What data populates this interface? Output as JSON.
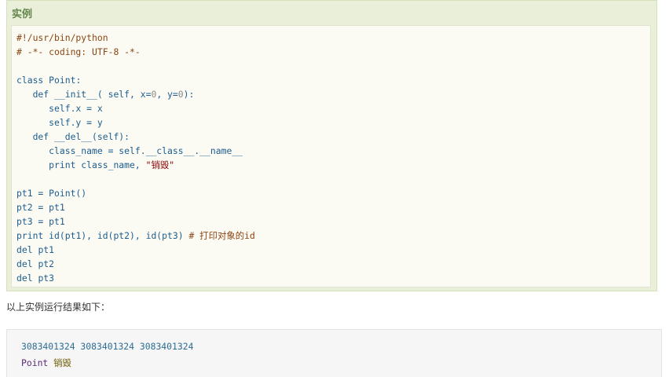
{
  "example": {
    "title": "实例",
    "code_lines": [
      [
        {
          "t": "#!/usr/bin/python",
          "c": "com"
        }
      ],
      [
        {
          "t": "# -*- coding: UTF-8 -*-",
          "c": "com"
        }
      ],
      [],
      [
        {
          "t": "class ",
          "c": "kw"
        },
        {
          "t": "Point:",
          "c": "pl"
        }
      ],
      [
        {
          "t": "   def ",
          "c": "kw"
        },
        {
          "t": "__init__( self, x=",
          "c": "pl"
        },
        {
          "t": "0",
          "c": "num"
        },
        {
          "t": ", y=",
          "c": "pl"
        },
        {
          "t": "0",
          "c": "num"
        },
        {
          "t": "):",
          "c": "pl"
        }
      ],
      [
        {
          "t": "      self.x = x",
          "c": "pl"
        }
      ],
      [
        {
          "t": "      self.y = y",
          "c": "pl"
        }
      ],
      [
        {
          "t": "   def ",
          "c": "kw"
        },
        {
          "t": "__del__(self):",
          "c": "pl"
        }
      ],
      [
        {
          "t": "      class_name = self.__class__.__name__",
          "c": "pl"
        }
      ],
      [
        {
          "t": "      print ",
          "c": "kw"
        },
        {
          "t": "class_name, ",
          "c": "pl"
        },
        {
          "t": "\"销毁\"",
          "c": "str"
        }
      ],
      [],
      [
        {
          "t": "pt1 = Point()",
          "c": "pl"
        }
      ],
      [
        {
          "t": "pt2 = pt1",
          "c": "pl"
        }
      ],
      [
        {
          "t": "pt3 = pt1",
          "c": "pl"
        }
      ],
      [
        {
          "t": "print ",
          "c": "kw"
        },
        {
          "t": "id(pt1), id(pt2), id(pt3) ",
          "c": "pl"
        },
        {
          "t": "# 打印对象的id",
          "c": "com"
        }
      ],
      [
        {
          "t": "del ",
          "c": "kw"
        },
        {
          "t": "pt1",
          "c": "pl"
        }
      ],
      [
        {
          "t": "del ",
          "c": "kw"
        },
        {
          "t": "pt2",
          "c": "pl"
        }
      ],
      [
        {
          "t": "del ",
          "c": "kw"
        },
        {
          "t": "pt3",
          "c": "pl"
        }
      ]
    ]
  },
  "result_note": "以上实例运行结果如下：",
  "output": {
    "line1": "3083401324 3083401324 3083401324",
    "line2_prefix": "Point ",
    "line2_text": "销毁"
  }
}
